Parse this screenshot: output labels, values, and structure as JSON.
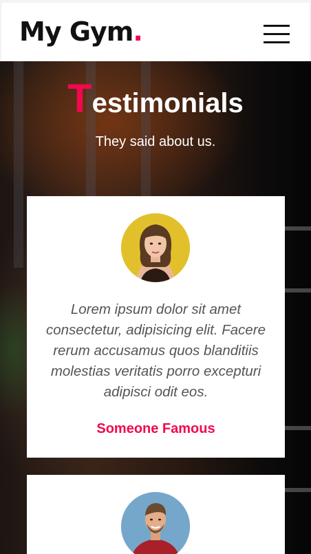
{
  "header": {
    "logo_text": "My Gym",
    "logo_dot": "."
  },
  "testimonials": {
    "title_first_letter": "T",
    "title_rest": "estimonials",
    "subtitle": "They said about us.",
    "items": [
      {
        "quote": "Lorem ipsum dolor sit amet consectetur, adipisicing elit. Facere rerum accusamus quos blanditiis molestias veritatis porro excepturi adipisci odit eos.",
        "author": "Someone Famous",
        "avatar": "woman-portrait"
      },
      {
        "avatar": "man-portrait"
      }
    ]
  },
  "colors": {
    "accent": "#f1084f",
    "text_dark": "#111111",
    "quote_text": "#555555"
  },
  "icons": {
    "menu": "hamburger-icon"
  }
}
